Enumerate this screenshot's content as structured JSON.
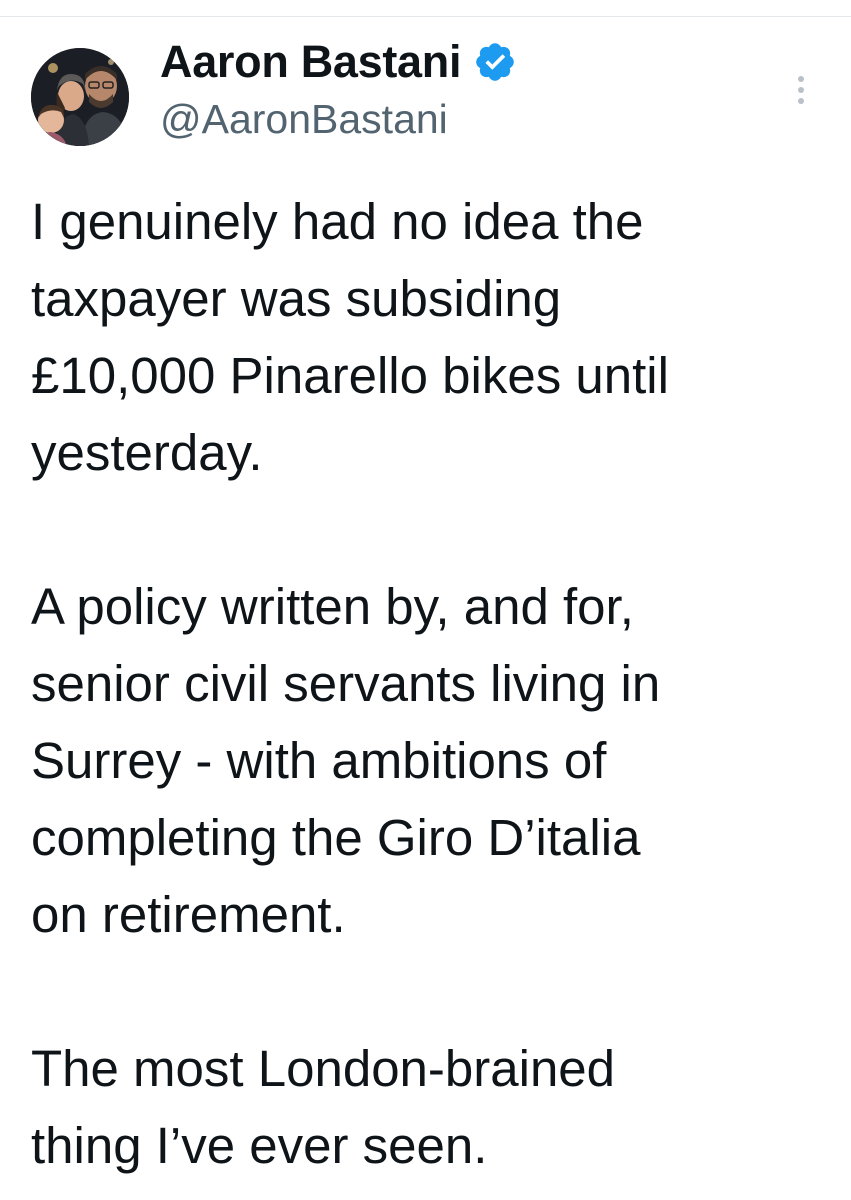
{
  "author": {
    "display_name": "Aaron Bastani",
    "handle": "@AaronBastani",
    "verified": true,
    "badge_color": "#1d9bf0"
  },
  "icons": {
    "verified": "verified-badge-icon",
    "more": "more-options-icon",
    "avatar": "profile-photo"
  },
  "tweet": {
    "paragraphs": [
      "I genuinely had no idea the\ntaxpayer was subsiding\n£10,000 Pinarello bikes until\nyesterday.",
      "A policy written by, and for,\nsenior civil servants living in\nSurrey - with ambitions of\ncompleting the Giro D’italia\non retirement.",
      "The most London-brained\nthing I’ve ever seen."
    ]
  },
  "colors": {
    "text": "#0f1419",
    "secondary_text": "#536471",
    "divider": "#e6e9ec"
  }
}
